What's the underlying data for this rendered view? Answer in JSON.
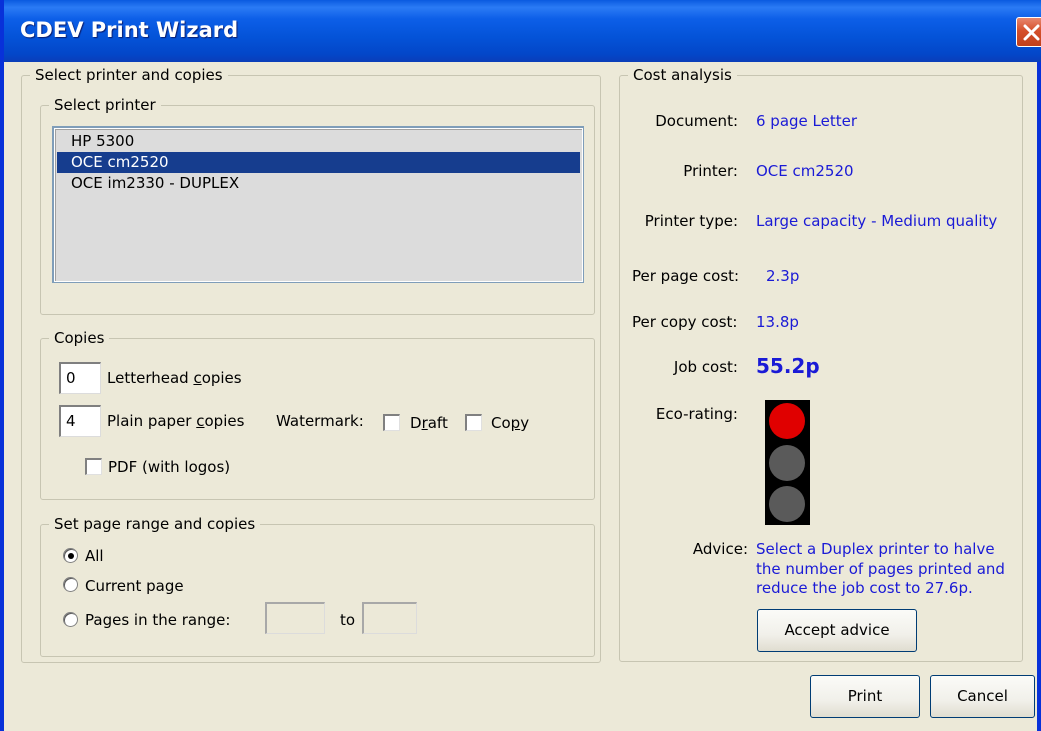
{
  "window": {
    "title": "CDEV Print Wizard"
  },
  "select_group": {
    "legend": "Select printer and copies"
  },
  "printer_group": {
    "legend": "Select printer",
    "printers": [
      "HP 5300",
      "OCE cm2520",
      "OCE im2330 - DUPLEX"
    ],
    "selected": "OCE cm2520"
  },
  "copies_group": {
    "legend": "Copies",
    "letterhead_value": "0",
    "letterhead_label_pre": "Letterhead ",
    "letterhead_label_u": "c",
    "letterhead_label_post": "opies",
    "plain_value": "4",
    "plain_label_pre": "Plain paper ",
    "plain_label_u": "c",
    "plain_label_post": "opies",
    "watermark_label": "Watermark:",
    "draft_pre": "D",
    "draft_u": "r",
    "draft_post": "aft",
    "draft_checked": false,
    "copy_pre": "Co",
    "copy_u": "p",
    "copy_post": "y",
    "copy_checked": false,
    "pdf_label": "PDF (with logos)",
    "pdf_checked": false
  },
  "range_group": {
    "legend": "Set page range and copies",
    "option_all": "All",
    "option_current": "Current page",
    "option_range": "Pages in the range:",
    "to_label": "to",
    "range_from": "",
    "range_to": "",
    "selected": "All"
  },
  "cost_group": {
    "legend": "Cost analysis",
    "document_label": "Document:",
    "document_value": "6 page Letter",
    "printer_label": "Printer:",
    "printer_value": "OCE cm2520",
    "printer_type_label": "Printer type:",
    "printer_type_value": "Large capacity - Medium quality",
    "per_page_label": "Per page cost:",
    "per_page_value": "2.3p",
    "per_copy_label": "Per copy cost:",
    "per_copy_value": "13.8p",
    "job_cost_label": "Job cost:",
    "job_cost_value": "55.2p",
    "eco_label": "Eco-rating:",
    "eco_active_light": "red",
    "advice_label": "Advice:",
    "advice_lines": [
      "Select a Duplex printer to halve",
      "the number of pages printed and",
      "reduce the job cost to 27.6p."
    ],
    "accept_button": "Accept advice"
  },
  "buttons": {
    "print": "Print",
    "cancel": "Cancel"
  },
  "colors": {
    "title_bar": "#0453d8",
    "value_text": "#1a1ad6",
    "selection": "#163d8e",
    "eco_red": "#e00000",
    "eco_off": "#5a5a5a"
  }
}
